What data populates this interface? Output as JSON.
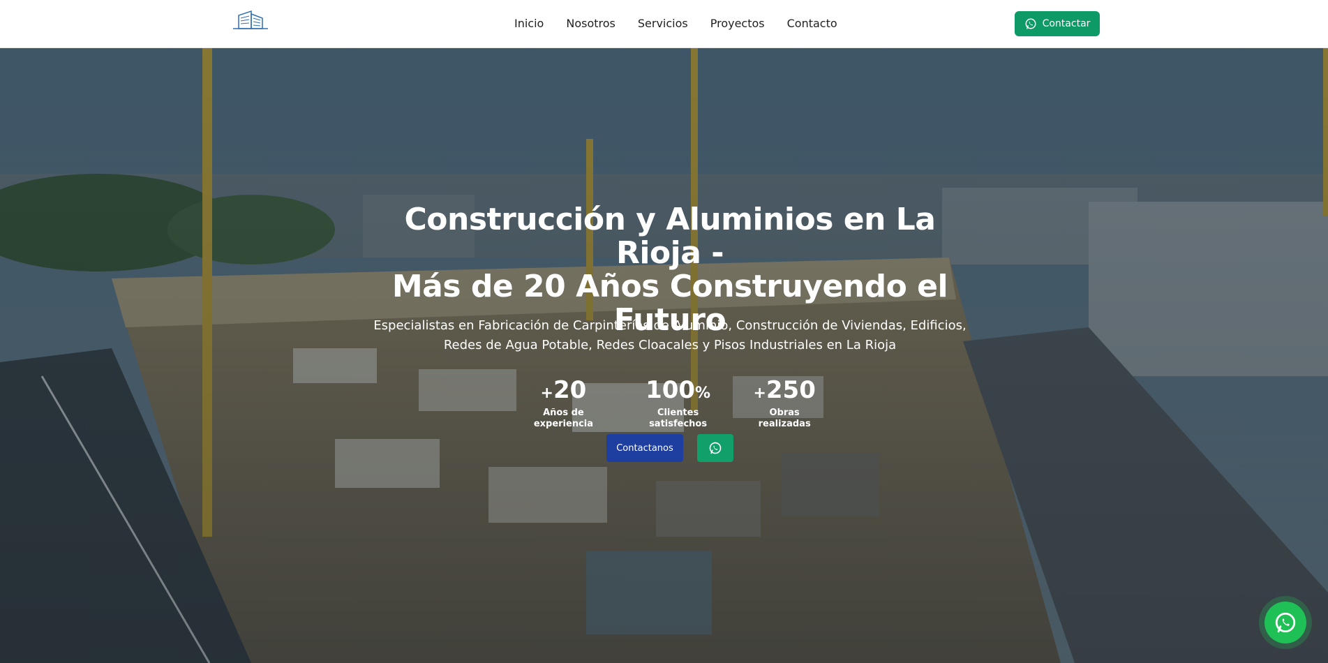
{
  "header": {
    "logo_icon": "building-logo",
    "nav": [
      "Inicio",
      "Nosotros",
      "Servicios",
      "Proyectos",
      "Contacto"
    ],
    "contact_label": "Contactar",
    "contact_icon": "whatsapp-icon"
  },
  "hero": {
    "title_line1": "Construcción y Aluminios en La Rioja -",
    "title_line2": "Más de 20 Años Construyendo el",
    "title_line3": "Futuro",
    "subtitle_line1": "Especialistas en Fabricación de Carpinterías de Aluminio, Construcción de Viviendas, Edificios,",
    "subtitle_line2": "Redes de Agua Potable, Redes Cloacales y Pisos Industriales en La Rioja",
    "stats": [
      {
        "prefix": "+",
        "value": "20",
        "suffix": "",
        "label": "Años de experiencia"
      },
      {
        "prefix": "",
        "value": "100",
        "suffix": "%",
        "label": "Clientes satisfechos"
      },
      {
        "prefix": "+",
        "value": "250",
        "suffix": "",
        "label": "Obras realizadas"
      }
    ],
    "cta_primary": "Contactanos",
    "cta_whatsapp_icon": "whatsapp-icon"
  },
  "floating": {
    "icon": "whatsapp-icon"
  },
  "colors": {
    "primary_blue": "#1f3fa0",
    "whatsapp_green": "#0d9a66",
    "float_green": "#1fc157",
    "logo_blue": "#2f6fb5"
  }
}
